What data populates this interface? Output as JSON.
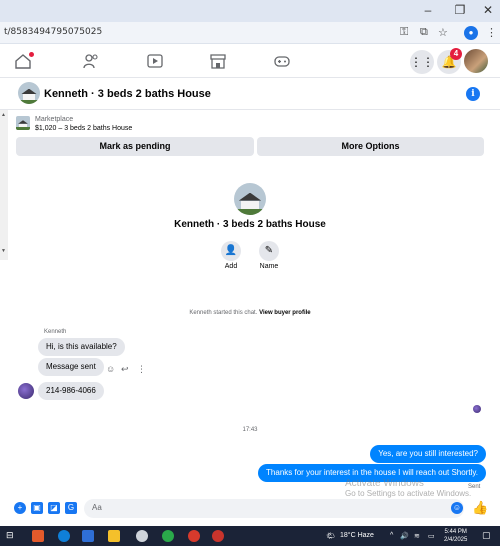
{
  "browser": {
    "url": "t/8583494795075025",
    "window_controls": {
      "minimize": "–",
      "restore": "❐",
      "close": "✕"
    }
  },
  "fb_nav": {
    "icons": [
      "home-icon",
      "friends-icon",
      "video-icon",
      "marketplace-icon",
      "gaming-icon"
    ],
    "notification_count": "4"
  },
  "chat": {
    "title": "Kenneth · 3 beds 2 baths House",
    "marketplace_label": "Marketplace",
    "listing_price": "$1,020 – 3 beds 2 baths House",
    "mark_pending_label": "Mark as pending",
    "more_options_label": "More Options",
    "profile_title": "Kenneth · 3 beds 2 baths House",
    "add_label": "Add",
    "name_label": "Name",
    "started_text": "Kenneth started this chat.",
    "view_buyer_profile": "View buyer profile",
    "sender_name": "Kenneth",
    "messages_in": [
      "Hi, is this available?",
      "Message sent",
      "214-986-4066"
    ],
    "timestamp": "17:43",
    "messages_out": [
      "Yes, are you still interested?",
      "Thanks for your interest in the house I will reach out Shortly."
    ],
    "sent_status": "Sent",
    "composer_placeholder": "Aa"
  },
  "watermark": {
    "line1": "Activate Windows",
    "line2": "Go to Settings to activate Windows."
  },
  "taskbar": {
    "weather": "18°C  Haze",
    "time": "5:44 PM",
    "date": "2/4/2025"
  },
  "colors": {
    "messenger_blue": "#0084ff",
    "fb_blue": "#1877f2",
    "bubble_grey": "#e4e6eb",
    "badge_red": "#e41e3f"
  }
}
